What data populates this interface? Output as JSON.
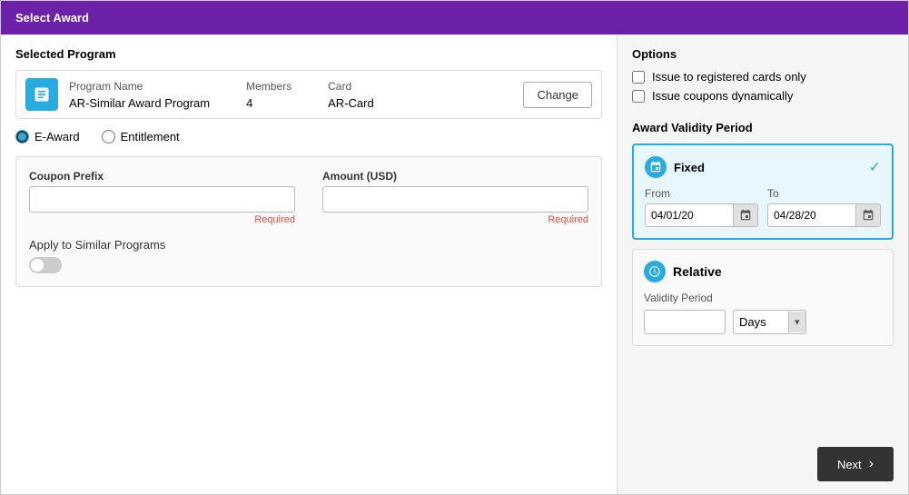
{
  "header": {
    "title": "Select Award"
  },
  "left": {
    "selected_program_label": "Selected Program",
    "program": {
      "name_label": "Program Name",
      "name_value": "AR-Similar Award Program",
      "members_label": "Members",
      "members_value": "4",
      "card_label": "Card",
      "card_value": "AR-Card",
      "change_btn": "Change"
    },
    "award_type": {
      "option1": "E-Award",
      "option2": "Entitlement"
    },
    "coupon_prefix": {
      "label": "Coupon Prefix",
      "placeholder": "",
      "required": "Required"
    },
    "amount": {
      "label": "Amount (USD)",
      "placeholder": "",
      "required": "Required"
    },
    "apply_to_similar": {
      "label": "Apply to Similar Programs"
    }
  },
  "right": {
    "options_title": "Options",
    "option1": "Issue to registered cards only",
    "option2": "Issue coupons dynamically",
    "validity_title": "Award Validity Period",
    "fixed": {
      "title": "Fixed",
      "from_label": "From",
      "from_value": "04/01/20",
      "to_label": "To",
      "to_value": "04/28/20"
    },
    "relative": {
      "title": "Relative",
      "validity_label": "Validity Period",
      "days_option": "Days"
    },
    "footer": {
      "next_label": "Next"
    }
  }
}
